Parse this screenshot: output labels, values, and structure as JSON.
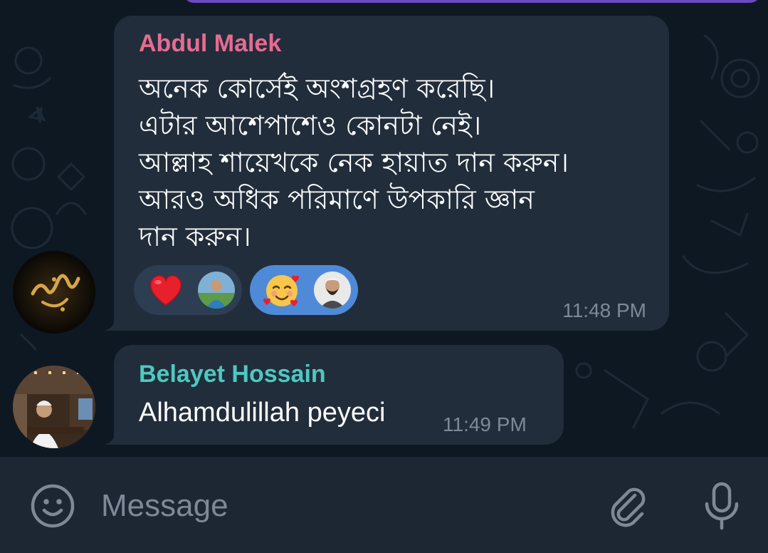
{
  "messages": [
    {
      "sender": "Abdul Malek",
      "lines": [
        "অনেক কোর্সেই অংশগ্রহণ করেছি।",
        "এটার আশেপাশেও কোনটা নেই।",
        "আল্লাহ শায়েখকে নেক হায়াত দান করুন।",
        "আরও অধিক পরিমাণে উপকারি জ্ঞান",
        "দান করুন।"
      ],
      "time": "11:48 PM",
      "reactions": [
        {
          "emoji": "heart-icon",
          "selected": false
        },
        {
          "emoji": "smiling-face-with-hearts-icon",
          "selected": true
        }
      ],
      "sender_name_color": "#e76b92"
    },
    {
      "sender": "Belayet Hossain",
      "text": "Alhamdulillah peyeci",
      "time": "11:49 PM",
      "sender_name_color": "#4ec8c0"
    }
  ],
  "composer": {
    "placeholder": "Message",
    "icons": [
      "smile-icon",
      "paperclip-icon",
      "microphone-icon"
    ]
  },
  "colors": {
    "chat_background": "#0e1822",
    "bubble": "#212d3b",
    "own_bubble_accent": "#6a4bc4",
    "selected_reaction": "#4f8ad8"
  }
}
